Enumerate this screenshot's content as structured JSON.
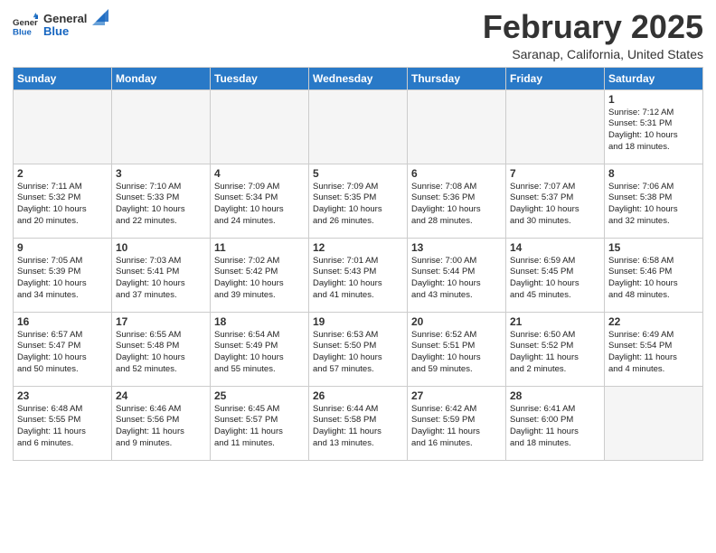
{
  "header": {
    "logo_line1": "General",
    "logo_line2": "Blue",
    "month_year": "February 2025",
    "location": "Saranap, California, United States"
  },
  "weekdays": [
    "Sunday",
    "Monday",
    "Tuesday",
    "Wednesday",
    "Thursday",
    "Friday",
    "Saturday"
  ],
  "weeks": [
    [
      {
        "day": "",
        "info": ""
      },
      {
        "day": "",
        "info": ""
      },
      {
        "day": "",
        "info": ""
      },
      {
        "day": "",
        "info": ""
      },
      {
        "day": "",
        "info": ""
      },
      {
        "day": "",
        "info": ""
      },
      {
        "day": "1",
        "info": "Sunrise: 7:12 AM\nSunset: 5:31 PM\nDaylight: 10 hours\nand 18 minutes."
      }
    ],
    [
      {
        "day": "2",
        "info": "Sunrise: 7:11 AM\nSunset: 5:32 PM\nDaylight: 10 hours\nand 20 minutes."
      },
      {
        "day": "3",
        "info": "Sunrise: 7:10 AM\nSunset: 5:33 PM\nDaylight: 10 hours\nand 22 minutes."
      },
      {
        "day": "4",
        "info": "Sunrise: 7:09 AM\nSunset: 5:34 PM\nDaylight: 10 hours\nand 24 minutes."
      },
      {
        "day": "5",
        "info": "Sunrise: 7:09 AM\nSunset: 5:35 PM\nDaylight: 10 hours\nand 26 minutes."
      },
      {
        "day": "6",
        "info": "Sunrise: 7:08 AM\nSunset: 5:36 PM\nDaylight: 10 hours\nand 28 minutes."
      },
      {
        "day": "7",
        "info": "Sunrise: 7:07 AM\nSunset: 5:37 PM\nDaylight: 10 hours\nand 30 minutes."
      },
      {
        "day": "8",
        "info": "Sunrise: 7:06 AM\nSunset: 5:38 PM\nDaylight: 10 hours\nand 32 minutes."
      }
    ],
    [
      {
        "day": "9",
        "info": "Sunrise: 7:05 AM\nSunset: 5:39 PM\nDaylight: 10 hours\nand 34 minutes."
      },
      {
        "day": "10",
        "info": "Sunrise: 7:03 AM\nSunset: 5:41 PM\nDaylight: 10 hours\nand 37 minutes."
      },
      {
        "day": "11",
        "info": "Sunrise: 7:02 AM\nSunset: 5:42 PM\nDaylight: 10 hours\nand 39 minutes."
      },
      {
        "day": "12",
        "info": "Sunrise: 7:01 AM\nSunset: 5:43 PM\nDaylight: 10 hours\nand 41 minutes."
      },
      {
        "day": "13",
        "info": "Sunrise: 7:00 AM\nSunset: 5:44 PM\nDaylight: 10 hours\nand 43 minutes."
      },
      {
        "day": "14",
        "info": "Sunrise: 6:59 AM\nSunset: 5:45 PM\nDaylight: 10 hours\nand 45 minutes."
      },
      {
        "day": "15",
        "info": "Sunrise: 6:58 AM\nSunset: 5:46 PM\nDaylight: 10 hours\nand 48 minutes."
      }
    ],
    [
      {
        "day": "16",
        "info": "Sunrise: 6:57 AM\nSunset: 5:47 PM\nDaylight: 10 hours\nand 50 minutes."
      },
      {
        "day": "17",
        "info": "Sunrise: 6:55 AM\nSunset: 5:48 PM\nDaylight: 10 hours\nand 52 minutes."
      },
      {
        "day": "18",
        "info": "Sunrise: 6:54 AM\nSunset: 5:49 PM\nDaylight: 10 hours\nand 55 minutes."
      },
      {
        "day": "19",
        "info": "Sunrise: 6:53 AM\nSunset: 5:50 PM\nDaylight: 10 hours\nand 57 minutes."
      },
      {
        "day": "20",
        "info": "Sunrise: 6:52 AM\nSunset: 5:51 PM\nDaylight: 10 hours\nand 59 minutes."
      },
      {
        "day": "21",
        "info": "Sunrise: 6:50 AM\nSunset: 5:52 PM\nDaylight: 11 hours\nand 2 minutes."
      },
      {
        "day": "22",
        "info": "Sunrise: 6:49 AM\nSunset: 5:54 PM\nDaylight: 11 hours\nand 4 minutes."
      }
    ],
    [
      {
        "day": "23",
        "info": "Sunrise: 6:48 AM\nSunset: 5:55 PM\nDaylight: 11 hours\nand 6 minutes."
      },
      {
        "day": "24",
        "info": "Sunrise: 6:46 AM\nSunset: 5:56 PM\nDaylight: 11 hours\nand 9 minutes."
      },
      {
        "day": "25",
        "info": "Sunrise: 6:45 AM\nSunset: 5:57 PM\nDaylight: 11 hours\nand 11 minutes."
      },
      {
        "day": "26",
        "info": "Sunrise: 6:44 AM\nSunset: 5:58 PM\nDaylight: 11 hours\nand 13 minutes."
      },
      {
        "day": "27",
        "info": "Sunrise: 6:42 AM\nSunset: 5:59 PM\nDaylight: 11 hours\nand 16 minutes."
      },
      {
        "day": "28",
        "info": "Sunrise: 6:41 AM\nSunset: 6:00 PM\nDaylight: 11 hours\nand 18 minutes."
      },
      {
        "day": "",
        "info": ""
      }
    ]
  ]
}
